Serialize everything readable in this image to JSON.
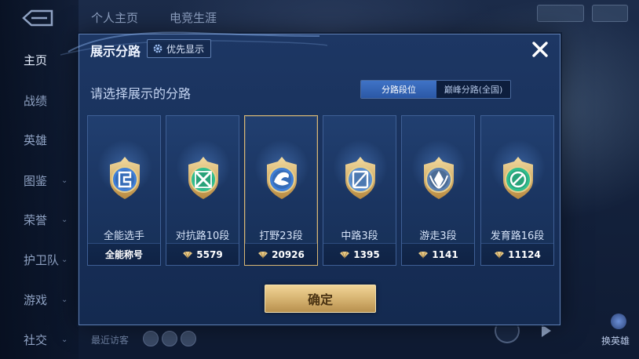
{
  "background": {
    "top_tabs": [
      "个人主页",
      "电竞生涯"
    ],
    "nav_items": [
      {
        "label": "主页",
        "active": true,
        "has_chevron": false
      },
      {
        "label": "战绩",
        "active": false,
        "has_chevron": false
      },
      {
        "label": "英雄",
        "active": false,
        "has_chevron": false
      },
      {
        "label": "图鉴",
        "active": false,
        "has_chevron": true
      },
      {
        "label": "荣誉",
        "active": false,
        "has_chevron": true
      },
      {
        "label": "护卫队",
        "active": false,
        "has_chevron": true
      },
      {
        "label": "游戏",
        "active": false,
        "has_chevron": true
      },
      {
        "label": "社交",
        "active": false,
        "has_chevron": true
      }
    ],
    "recent_visitors_label": "最近访客",
    "swap_hero_label": "换英雄"
  },
  "modal": {
    "title": "展示分路",
    "pref_button_label": "优先显示",
    "subtitle": "请选择展示的分路",
    "segment": {
      "options": [
        "分路段位",
        "巅峰分路(全国)"
      ],
      "active_index": 0
    },
    "cards": [
      {
        "name": "全能选手",
        "value": "全能称号",
        "show_diamond": false,
        "selected": false,
        "emblem": "all-round-emblem-icon",
        "color": "#3f7fd8"
      },
      {
        "name": "对抗路10段",
        "value": "5579",
        "show_diamond": true,
        "selected": false,
        "emblem": "clash-lane-emblem-icon",
        "color": "#2fbf8f"
      },
      {
        "name": "打野23段",
        "value": "20926",
        "show_diamond": true,
        "selected": true,
        "emblem": "jungle-emblem-icon",
        "color": "#3f7fd8"
      },
      {
        "name": "中路3段",
        "value": "1395",
        "show_diamond": true,
        "selected": false,
        "emblem": "mid-lane-emblem-icon",
        "color": "#5a8fd0"
      },
      {
        "name": "游走3段",
        "value": "1141",
        "show_diamond": true,
        "selected": false,
        "emblem": "roam-emblem-icon",
        "color": "#5a7fb0"
      },
      {
        "name": "发育路16段",
        "value": "11124",
        "show_diamond": true,
        "selected": false,
        "emblem": "farm-lane-emblem-icon",
        "color": "#2fbf8f"
      }
    ],
    "confirm_label": "确定"
  },
  "colors": {
    "gold_accent": "#d8b775",
    "active_segment": "#3f73c6",
    "modal_bg": "#1d3764"
  }
}
